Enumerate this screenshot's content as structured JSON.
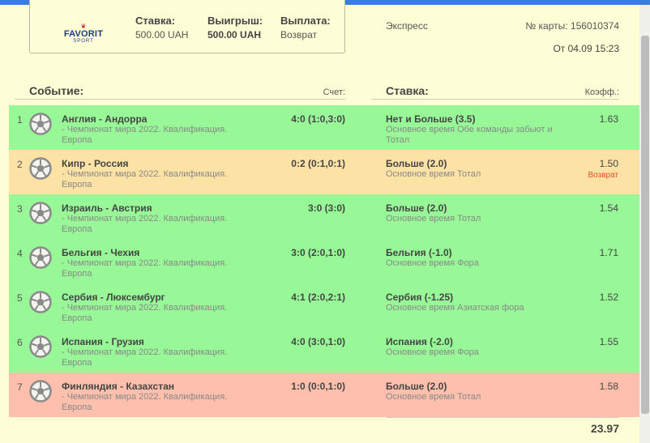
{
  "summary": {
    "logo": {
      "brand": "FAVORIT",
      "sub": "SPORT"
    },
    "stake": {
      "label": "Ставка:",
      "value": "500.00 UAH"
    },
    "win": {
      "label": "Выигрыш:",
      "value": "500.00 UAH"
    },
    "payout": {
      "label": "Выплата:",
      "value": "Возврат"
    },
    "type": "Экспресс",
    "card_number": "№ карты: 156010374",
    "date": "От 04.09 15:23"
  },
  "headers": {
    "event": "Событие:",
    "score": "Счет:",
    "bet": "Ставка:",
    "coef": "Коэфф.:"
  },
  "rows": [
    {
      "num": "1",
      "match": "Англия - Андорра",
      "league": "- Чемпионат мира 2022. Квалификация. Европа",
      "score": "4:0 (1:0,3:0)",
      "bet": "Нет и Больше (3.5)",
      "bet_desc": "Основное время Обе команды забьют и Тотал",
      "coef": "1.63",
      "status": "",
      "color": "#98f898"
    },
    {
      "num": "2",
      "match": "Кипр - Россия",
      "league": "- Чемпионат мира 2022. Квалификация. Европа",
      "score": "0:2 (0:1,0:1)",
      "bet": "Больше (2.0)",
      "bet_desc": "Основное время Тотал",
      "coef": "1.50",
      "status": "Возврат",
      "color": "#fde2a6"
    },
    {
      "num": "3",
      "match": "Израиль - Австрия",
      "league": "- Чемпионат мира 2022. Квалификация. Европа",
      "score": "3:0 (3:0)",
      "bet": "Больше (2.0)",
      "bet_desc": "Основное время Тотал",
      "coef": "1.54",
      "status": "",
      "color": "#98f898"
    },
    {
      "num": "4",
      "match": "Бельгия - Чехия",
      "league": "- Чемпионат мира 2022. Квалификация. Европа",
      "score": "3:0 (2:0,1:0)",
      "bet": "Бельгия (-1.0)",
      "bet_desc": "Основное время Фора",
      "coef": "1.71",
      "status": "",
      "color": "#98f898"
    },
    {
      "num": "5",
      "match": "Сербия - Люксембург",
      "league": "- Чемпионат мира 2022. Квалификация. Европа",
      "score": "4:1 (2:0,2:1)",
      "bet": "Сербия (-1.25)",
      "bet_desc": "Основное время Азиатская фора",
      "coef": "1.52",
      "status": "",
      "color": "#98f898"
    },
    {
      "num": "6",
      "match": "Испания - Грузия",
      "league": "- Чемпионат мира 2022. Квалификация. Европа",
      "score": "4:0 (3:0,1:0)",
      "bet": "Испания (-2.0)",
      "bet_desc": "Основное время Фора",
      "coef": "1.55",
      "status": "",
      "color": "#98f898"
    },
    {
      "num": "7",
      "match": "Финляндия - Казахстан",
      "league": "- Чемпионат мира 2022. Квалификация. Европа",
      "score": "1:0 (0:0,1:0)",
      "bet": "Больше (2.0)",
      "bet_desc": "Основное время Тотал",
      "coef": "1.58",
      "status": "",
      "color": "#fec0ad"
    }
  ],
  "total": "23.97",
  "icons": {
    "sport": "soccer-ball-icon"
  }
}
